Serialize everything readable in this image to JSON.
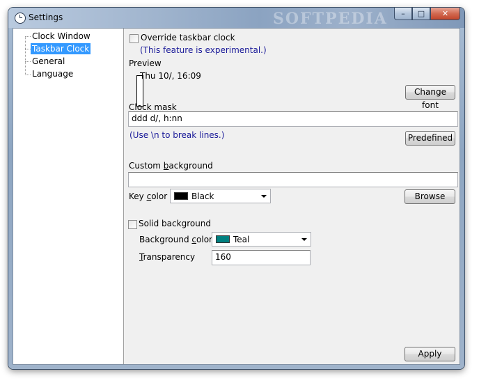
{
  "window": {
    "title": "Settings",
    "watermark": "SOFTPEDIA",
    "controls": {
      "minimize": "–",
      "maximize": "□",
      "close": "✕"
    }
  },
  "tree": {
    "items": [
      {
        "label": "Clock Window",
        "selected": false
      },
      {
        "label": "Taskbar Clock",
        "selected": true
      },
      {
        "label": "General",
        "selected": false
      },
      {
        "label": "Language",
        "selected": false
      }
    ]
  },
  "panel": {
    "override_label": "Override taskbar clock",
    "experimental_note": "(This feature is experimental.)",
    "preview_label": "Preview",
    "preview_text": "Thu 10/, 16:09",
    "change_font_button": "Change font",
    "clock_mask_label": "Clock mask",
    "clock_mask_value": "ddd d/, h:nn",
    "hint": "(Use \\n to break lines.)",
    "predefined_button": "Predefined",
    "custom_background_label_pre": "Custom ",
    "custom_background_label_u": "b",
    "custom_background_label_post": "ackground",
    "custom_background_value": "",
    "key_color_label_pre": "Key ",
    "key_color_label_u": "c",
    "key_color_label_post": "olor",
    "key_color_value": "Black",
    "key_color_hex": "#000000",
    "browse_button": "Browse",
    "solid_background_label": "Solid background",
    "background_color_label_pre": "Background ",
    "background_color_label_u": "c",
    "background_color_label_post": "olor",
    "background_color_value": "Teal",
    "background_color_hex": "#008080",
    "transparency_label_u": "T",
    "transparency_label_post": "ransparency",
    "transparency_value": "160",
    "apply_button": "Apply"
  }
}
